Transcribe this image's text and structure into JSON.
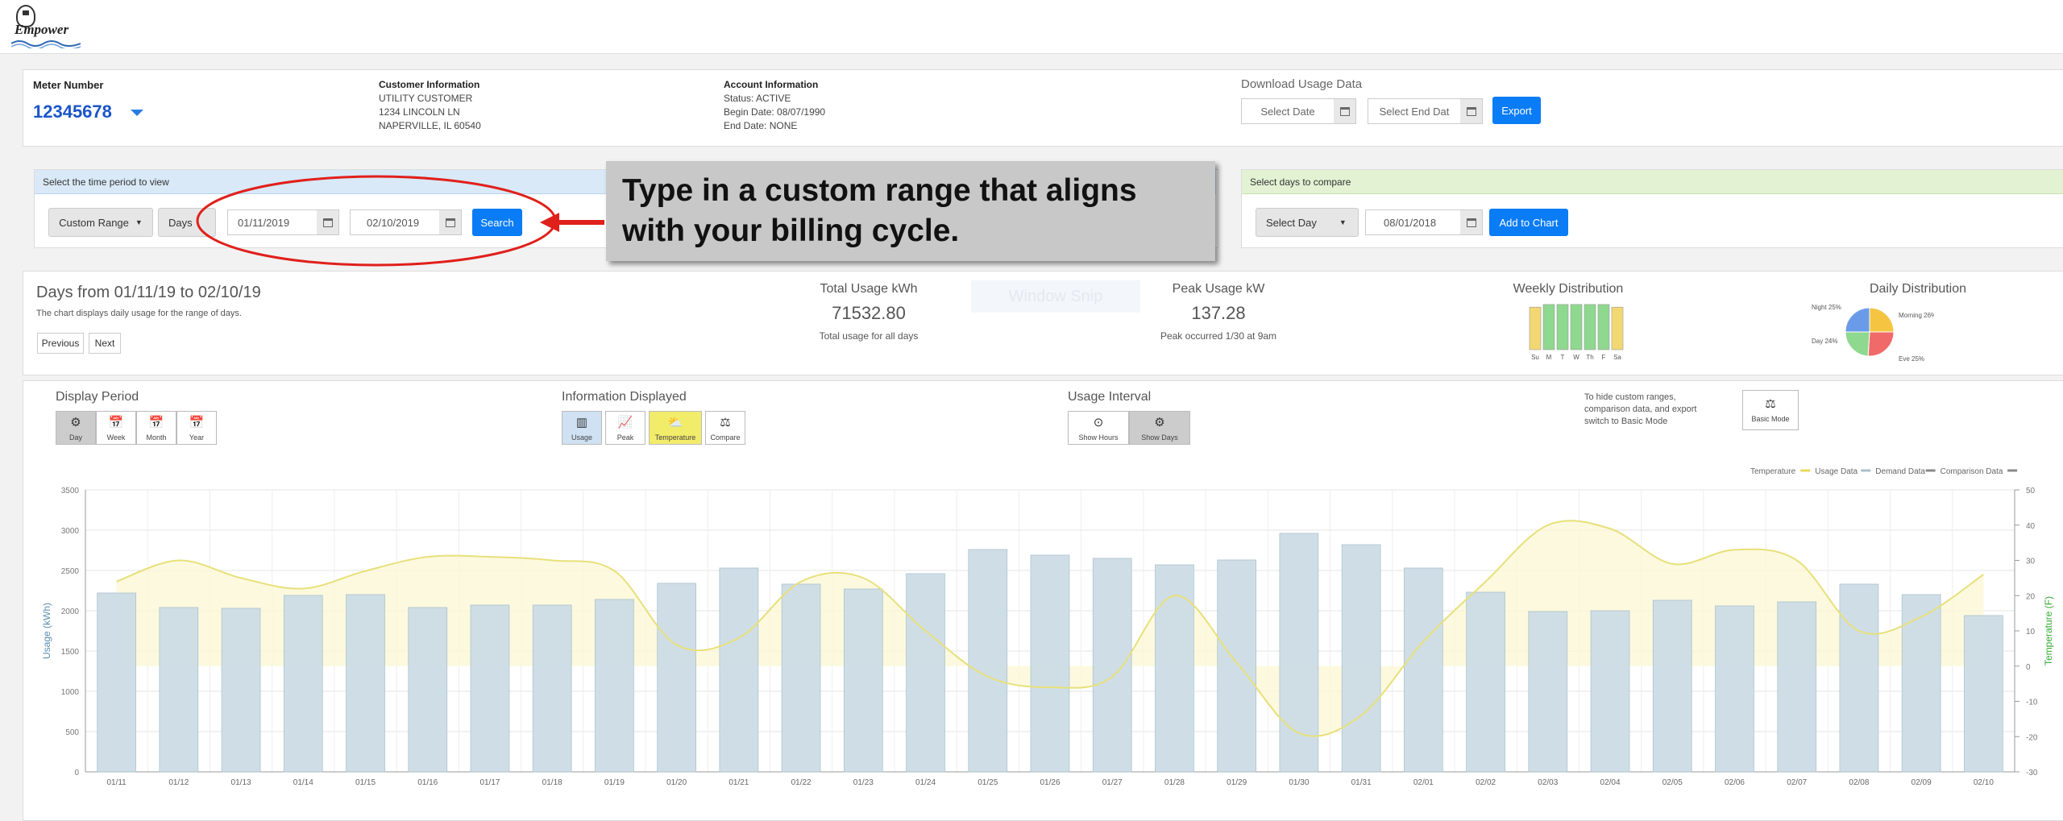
{
  "app": {
    "logo_text": "Empower"
  },
  "meter": {
    "label": "Meter Number",
    "number": "12345678"
  },
  "customer": {
    "title": "Customer Information",
    "lines": [
      "UTILITY CUSTOMER",
      "1234 LINCOLN LN",
      "NAPERVILLE, IL 60540"
    ]
  },
  "account": {
    "title": "Account Information",
    "lines": [
      "Status: ACTIVE",
      "Begin Date: 08/07/1990",
      "End Date: NONE"
    ]
  },
  "download": {
    "title": "Download Usage Data",
    "start_placeholder": "Select Date",
    "end_placeholder": "Select End Dat",
    "export_label": "Export"
  },
  "period": {
    "header": "Select the time period to view",
    "range_label": "Custom Range",
    "unit_label": "Days",
    "start_date": "01/11/2019",
    "end_date": "02/10/2019",
    "search_label": "Search"
  },
  "compare": {
    "header": "Select days to compare",
    "select_label": "Select Day",
    "date": "08/01/2018",
    "add_label": "Add to Chart"
  },
  "callout": {
    "line1": "Type in a custom range that aligns",
    "line2": "with your billing cycle."
  },
  "summary": {
    "title": "Days from 01/11/19 to 02/10/19",
    "desc": "The chart displays daily usage for the range of days.",
    "prev_label": "Previous",
    "next_label": "Next"
  },
  "watermark": "Window Snip",
  "total_usage": {
    "title": "Total Usage kWh",
    "value": "71532.80",
    "sub": "Total usage for all days"
  },
  "peak_usage": {
    "title": "Peak Usage kW",
    "value": "137.28",
    "sub": "Peak occurred 1/30 at 9am"
  },
  "weekly": {
    "title": "Weekly Distribution",
    "days": [
      "Su",
      "M",
      "T",
      "W",
      "Th",
      "F",
      "Sa"
    ],
    "levels": [
      0.8,
      0.85,
      0.85,
      0.85,
      0.85,
      0.85,
      0.8
    ],
    "colors": [
      "#f2d873",
      "#8fd88f",
      "#8fd88f",
      "#8fd88f",
      "#8fd88f",
      "#8fd88f",
      "#f2d873"
    ]
  },
  "daily_dist": {
    "title": "Daily Distribution",
    "slices": [
      {
        "label": "Night 25%",
        "value": 25,
        "color": "#f5c542"
      },
      {
        "label": "Morning 26%",
        "value": 26,
        "color": "#f06a6a"
      },
      {
        "label": "Day 24%",
        "value": 24,
        "color": "#8fd88f"
      },
      {
        "label": "Eve 25%",
        "value": 25,
        "color": "#6b9be8"
      }
    ]
  },
  "display_period": {
    "title": "Display Period",
    "buttons": [
      {
        "label": "Day",
        "icon": "gear-icon",
        "glyph": "⚙"
      },
      {
        "label": "Week",
        "icon": "calendar-week-icon",
        "glyph": "📅"
      },
      {
        "label": "Month",
        "icon": "calendar-month-icon",
        "glyph": "📅"
      },
      {
        "label": "Year",
        "icon": "calendar-year-icon",
        "glyph": "📅"
      }
    ]
  },
  "info_displayed": {
    "title": "Information Displayed",
    "buttons": [
      {
        "label": "Usage",
        "icon": "bar-chart-icon",
        "glyph": "▥"
      },
      {
        "label": "Peak",
        "icon": "line-chart-icon",
        "glyph": "📈"
      },
      {
        "label": "Temperature",
        "icon": "weather-icon",
        "glyph": "⛅"
      },
      {
        "label": "Compare",
        "icon": "scale-icon",
        "glyph": "⚖"
      }
    ]
  },
  "usage_interval": {
    "title": "Usage Interval",
    "buttons": [
      {
        "label": "Show Hours",
        "icon": "clock-icon",
        "glyph": "⊙"
      },
      {
        "label": "Show Days",
        "icon": "gear-icon",
        "glyph": "⚙"
      }
    ]
  },
  "basic_mode": {
    "text": [
      "To hide custom ranges,",
      "comparison data, and export",
      "switch to Basic Mode"
    ],
    "button_label": "Basic Mode",
    "glyph": "⚖"
  },
  "colors": {
    "blue": "#0a7cf5",
    "bar": "#cddde5",
    "temp_line": "#e8e07a",
    "temp_fill": "#fbf8d6",
    "header_blue": "#d9e9f7",
    "header_green": "#e2f2d2",
    "annotation_red": "#e0201b"
  },
  "chart_data": {
    "type": "bar",
    "legend": [
      "Temperature",
      "Usage Data",
      "Demand Data",
      "Comparison Data"
    ],
    "legend_position": "top-right",
    "ylabel": "Usage (kWh)",
    "y2label": "Temperature (F)",
    "ylim": [
      0,
      3500
    ],
    "y2lim": [
      -30,
      50
    ],
    "yticks": [
      "0",
      "500",
      "1000",
      "1500",
      "2000",
      "2500",
      "3000",
      "3500"
    ],
    "y2ticks": [
      "-30",
      "-20",
      "-10",
      "0",
      "10",
      "20",
      "30",
      "40",
      "50"
    ],
    "grid": true,
    "categories": [
      "01/11",
      "01/12",
      "01/13",
      "01/14",
      "01/15",
      "01/16",
      "01/17",
      "01/18",
      "01/19",
      "01/20",
      "01/21",
      "01/22",
      "01/23",
      "01/24",
      "01/25",
      "01/26",
      "01/27",
      "01/28",
      "01/29",
      "01/30",
      "01/31",
      "02/01",
      "02/02",
      "02/03",
      "02/04",
      "02/05",
      "02/06",
      "02/07",
      "02/08",
      "02/09",
      "02/10"
    ],
    "series": [
      {
        "name": "Usage Data",
        "type": "bar",
        "values": [
          2220,
          2040,
          2030,
          2190,
          2200,
          2040,
          2070,
          2070,
          2140,
          2340,
          2530,
          2330,
          2270,
          2460,
          2760,
          2690,
          2650,
          2570,
          2630,
          2960,
          2820,
          2530,
          2230,
          1990,
          2000,
          2130,
          2060,
          2110,
          2330,
          2200,
          1940
        ]
      },
      {
        "name": "Temperature",
        "type": "line",
        "values": [
          24,
          30,
          25,
          22,
          27,
          31,
          31,
          30,
          27,
          6,
          8,
          24,
          25,
          10,
          -3,
          -6,
          -3,
          20,
          1,
          -19,
          -14,
          7,
          24,
          40,
          39,
          29,
          33,
          30,
          10,
          14,
          26
        ]
      }
    ]
  }
}
